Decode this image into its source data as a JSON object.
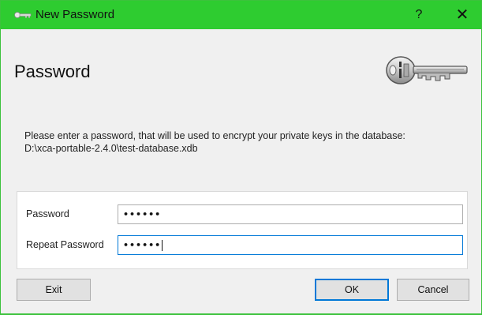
{
  "window": {
    "title": "New Password",
    "help_label": "?",
    "close_label": "✕",
    "accent_color": "#2ecc30"
  },
  "header": {
    "heading": "Password",
    "image_icon": "key-icon"
  },
  "description": {
    "line1": "Please enter a password, that will be used to encrypt your private keys in the database:",
    "line2": "D:\\xca-portable-2.4.0\\test-database.xdb"
  },
  "form": {
    "password_label": "Password",
    "password_value": "••••••",
    "repeat_label": "Repeat Password",
    "repeat_value": "••••••"
  },
  "buttons": {
    "exit": "Exit",
    "ok": "OK",
    "cancel": "Cancel"
  }
}
